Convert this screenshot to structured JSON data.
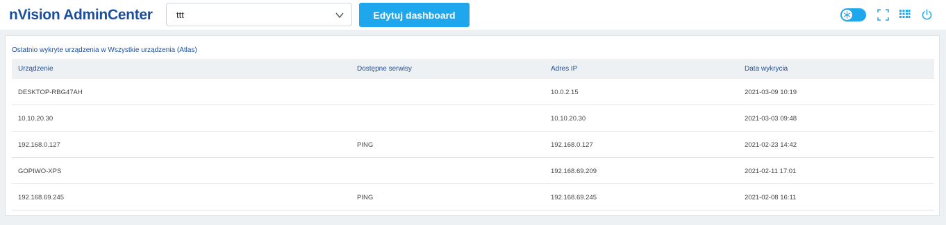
{
  "header": {
    "logo": "nVision AdminCenter",
    "dashboard_select": {
      "value": "ttt"
    },
    "edit_button": "Edytuj dashboard",
    "icons": [
      "theme-toggle-icon",
      "fullscreen-icon",
      "apps-grid-icon",
      "power-icon"
    ]
  },
  "panel": {
    "title": "Ostatnio wykryte urządzenia w Wszystkie urządzenia (Atlas)",
    "columns": [
      "Urządzenie",
      "Dostępne serwisy",
      "Adres IP",
      "Data wykrycia"
    ],
    "rows": [
      [
        "DESKTOP-RBG47AH",
        "",
        "10.0.2.15",
        "2021-03-09 10:19"
      ],
      [
        "10.10.20.30",
        "",
        "10.10.20.30",
        "2021-03-03 09:48"
      ],
      [
        "192.168.0.127",
        "PING",
        "192.168.0.127",
        "2021-02-23 14:42"
      ],
      [
        "GOPIWO-XPS",
        "",
        "192.168.69.209",
        "2021-02-11 17:01"
      ],
      [
        "192.168.69.245",
        "PING",
        "192.168.69.245",
        "2021-02-08 16:11"
      ]
    ]
  },
  "colors": {
    "brand": "#1b4f9c",
    "accent": "#1fa7ee",
    "background": "#eef1f4"
  }
}
